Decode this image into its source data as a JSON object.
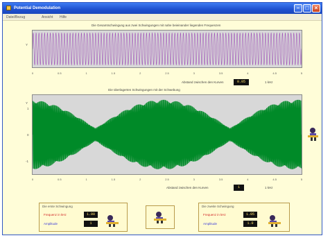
{
  "window": {
    "title": "Potential Demodulation"
  },
  "menu": [
    "Datei/Bezug",
    "Ansicht",
    "Hilfe"
  ],
  "plot1": {
    "title": "Die Gesamtschwingung aus zwei Schwingungen mit nahe beieinander liegenden Frequenzen",
    "ylabel": "Y",
    "xticks": [
      "0",
      "0.5",
      "1",
      "1.5",
      "2",
      "2.5",
      "3",
      "3.5",
      "4",
      "4.5",
      "5"
    ],
    "control_label": "Abstand zwischen den Kurven",
    "value": "0.05",
    "unit": "1 kHz",
    "color": "#a052b8",
    "bg": "#d8d8d8"
  },
  "plot2": {
    "title": "Die überlagerten Schwingungen mit der Schwebung",
    "ylabel": "Y",
    "yticks": [
      "1",
      "0",
      "-1"
    ],
    "xticks": [
      "0",
      "0.5",
      "1",
      "1.5",
      "2",
      "2.5",
      "3",
      "3.5",
      "4",
      "4.5",
      "5"
    ],
    "control_label": "Abstand zwischen den Kurven",
    "value": "1",
    "unit": "1 kHz",
    "color": "#008a28",
    "bg": "#d8d8d8"
  },
  "panel_left": {
    "title": "Die erste Schwingung",
    "freq_label": "Frequenz in kHz",
    "freq_value": "1.00",
    "amp_label": "Amplitude",
    "amp_value": "1"
  },
  "panel_right": {
    "title": "Die zweite Schwingung",
    "freq_label": "Frequenz in kHz",
    "freq_value": "1.05",
    "amp_label": "Amplitude",
    "amp_value": "1.0"
  }
}
